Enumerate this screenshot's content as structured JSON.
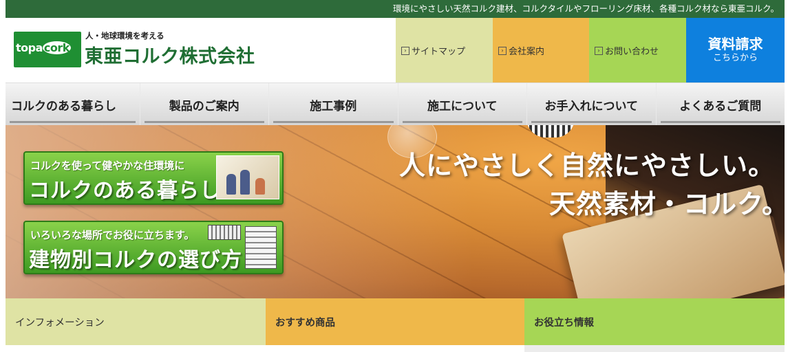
{
  "tagline": "環境にやさしい天然コルク建材、コルクタイルやフローリング床材、各種コルク材なら東亜コルク。",
  "logo": {
    "mark_topa": "topa",
    "mark_cork": "cork",
    "tagline": "人・地球環境を考える",
    "company_name": "東亜コルク株式会社"
  },
  "header_nav": {
    "sitemap": "サイトマップ",
    "company": "会社案内",
    "contact": "お問い合わせ",
    "request_main": "資料請求",
    "request_sub": "こちらから"
  },
  "main_nav": [
    "コルクのある暮らし",
    "製品のご案内",
    "施工事例",
    "施工について",
    "お手入れについて",
    "よくあるご質問"
  ],
  "hero": {
    "slogan_line1": "人にやさしく自然にやさしい。",
    "slogan_line2": "天然素材・コルク。",
    "banner1_small": "コルクを使って健やかな住環境に",
    "banner1_big": "コルクのある暮らし",
    "banner2_small": "いろいろな場所でお役に立ちます。",
    "banner2_big": "建物別コルクの選び方"
  },
  "columns": {
    "info": "インフォメーション",
    "recommended": "おすすめ商品",
    "useful": "お役立ち情報"
  },
  "colors": {
    "topbar": "#2e6b3a",
    "brand_green": "#1f8f33",
    "sitemap_bg": "#dfe3a4",
    "company_bg": "#efb84a",
    "contact_bg": "#a6d655",
    "request_bg": "#0e80de"
  }
}
